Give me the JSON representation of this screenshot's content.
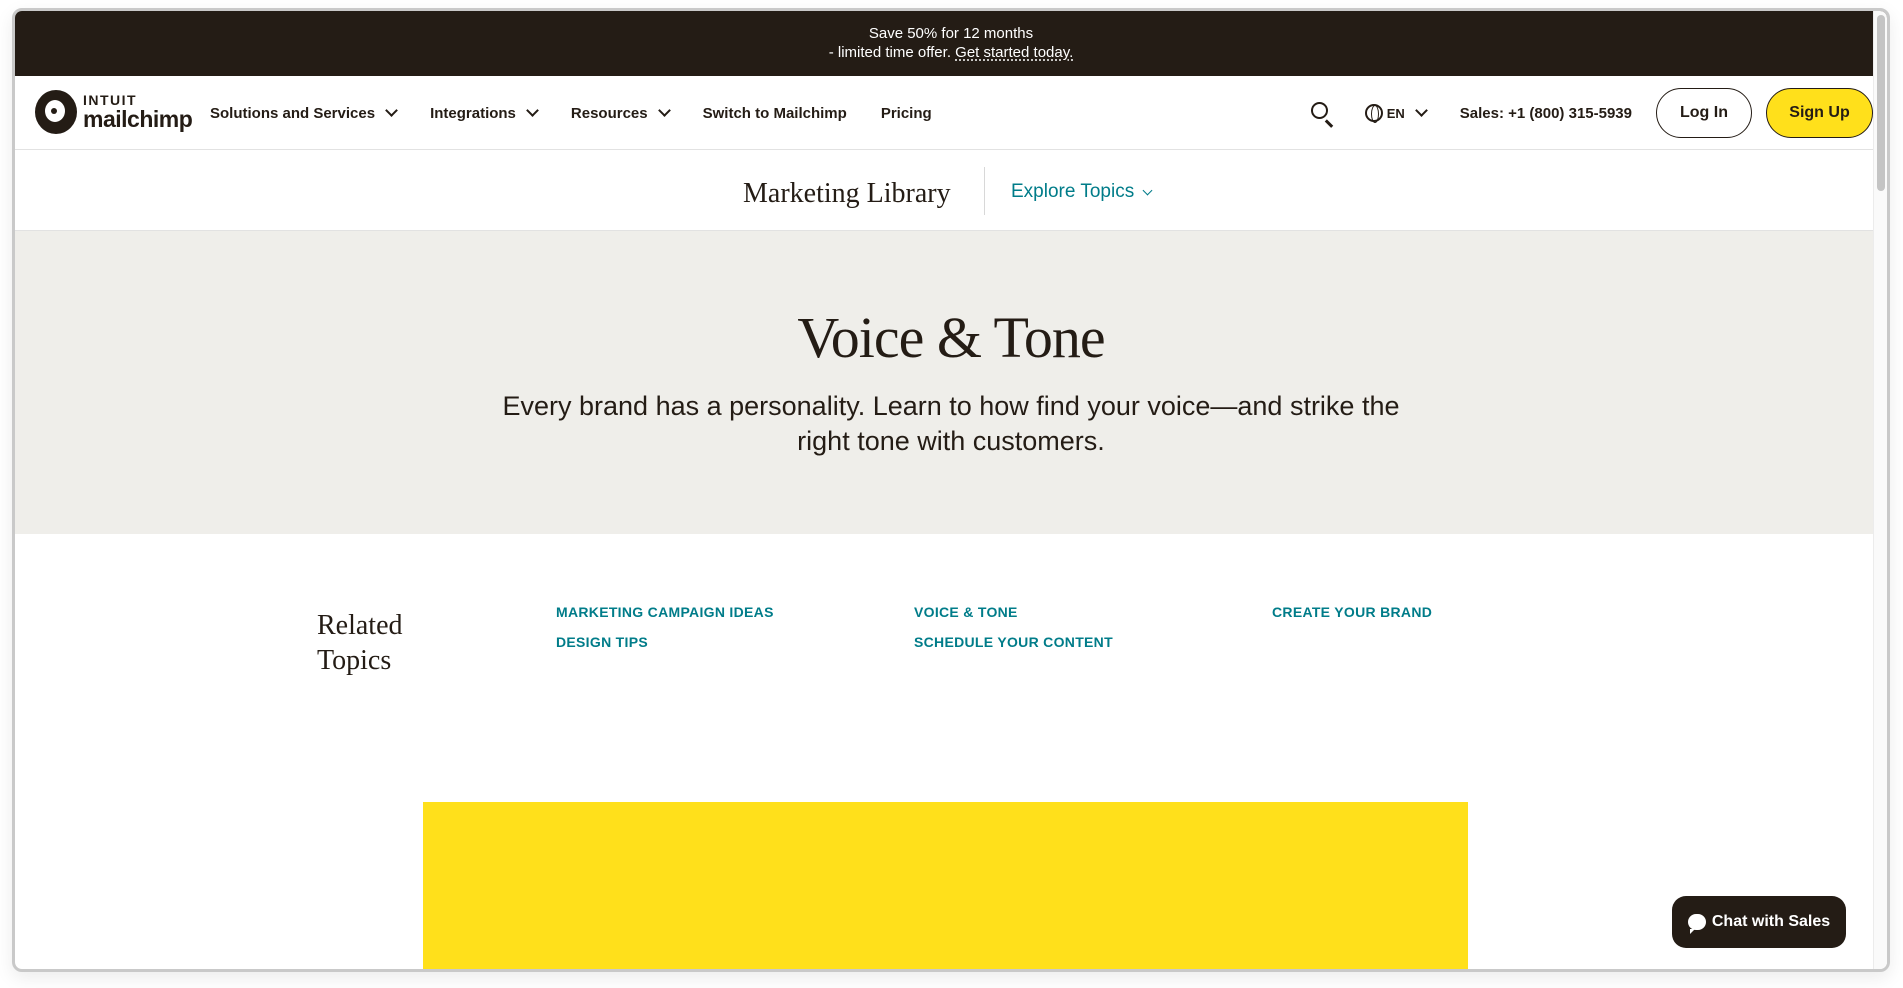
{
  "promo": {
    "line1": "Save 50% for 12 months",
    "line2_prefix": "- limited time offer. ",
    "line2_link": "Get started today."
  },
  "nav": {
    "logo_line1": "INTUIT",
    "logo_line2": "mailchimp",
    "items": [
      {
        "label": "Solutions and Services",
        "dropdown": true
      },
      {
        "label": "Integrations",
        "dropdown": true
      },
      {
        "label": "Resources",
        "dropdown": true
      },
      {
        "label": "Switch to Mailchimp",
        "dropdown": false
      },
      {
        "label": "Pricing",
        "dropdown": false
      }
    ],
    "lang": "EN",
    "sales": "Sales: +1 (800) 315-5939",
    "login": "Log In",
    "signup": "Sign Up"
  },
  "library": {
    "title": "Marketing Library",
    "explore": "Explore Topics"
  },
  "hero": {
    "title": "Voice & Tone",
    "subtitle": "Every brand has a personality. Learn to how find your voice—and strike the right tone with customers."
  },
  "related": {
    "title": "Related Topics",
    "topics": [
      "MARKETING CAMPAIGN IDEAS",
      "DESIGN TIPS",
      "VOICE & TONE",
      "SCHEDULE YOUR CONTENT",
      "CREATE YOUR BRAND"
    ]
  },
  "chat": {
    "label": "Chat with Sales"
  },
  "colors": {
    "brand_dark": "#241c15",
    "brand_yellow": "#ffe01b",
    "link_teal": "#007c89",
    "hero_bg": "#efeeea"
  }
}
